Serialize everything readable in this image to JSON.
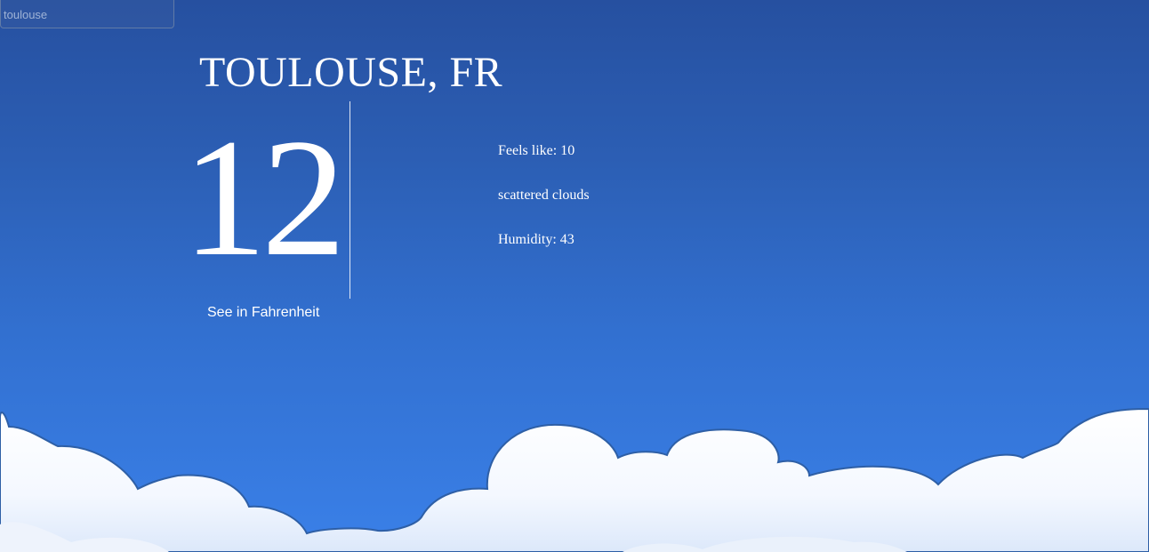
{
  "search": {
    "value": "toulouse"
  },
  "weather": {
    "city": "TOULOUSE, FR",
    "temperature": "12",
    "feels_like": "Feels like: 10",
    "description": "scattered clouds",
    "humidity": "Humidity: 43"
  },
  "unit_toggle": {
    "label": "See in Fahrenheit"
  }
}
